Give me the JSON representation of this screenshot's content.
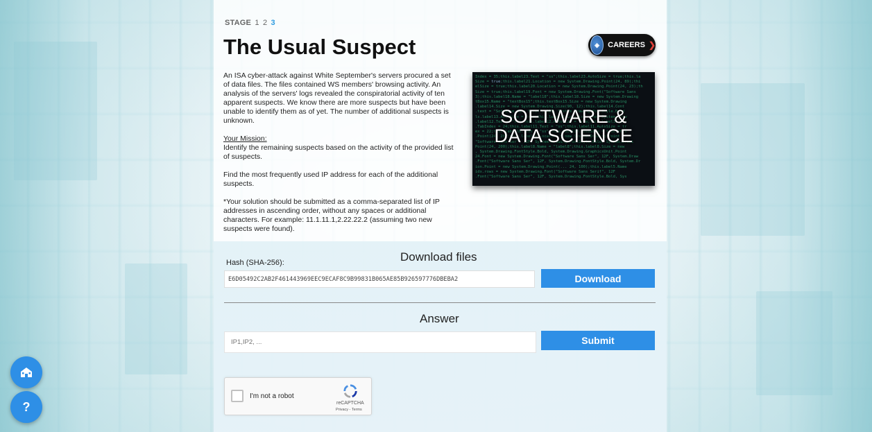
{
  "stage": {
    "label": "STAGE",
    "steps": [
      "1",
      "2",
      "3"
    ],
    "active": "3"
  },
  "page_title": "The Usual Suspect",
  "careers_button": {
    "label": "CAREERS",
    "icon": "chevron-right-icon"
  },
  "description": {
    "intro": "An ISA cyber-attack against White September's servers procured a set of data files. The files contained WS members' browsing activity. An analysis of the servers' logs revealed the conspiratorial activity of ten apparent suspects. We know there are more suspects but have been unable to identify them as of yet. The number of additional suspects is unknown.",
    "mission_heading": "Your Mission:",
    "mission_text": "Identify the remaining suspects based on the activity of the provided list of suspects.",
    "task_text": "Find the most frequently used IP address for each of the additional suspects.",
    "format_text": "*Your solution should be submitted as a comma-separated list of IP addresses in ascending order, without any spaces or additional characters. For example: 11.1.11.1,2.22.22.2 (assuming two new suspects were found)."
  },
  "hero_image": {
    "line1": "SOFTWARE &",
    "line2": "DATA SCIENCE"
  },
  "download": {
    "heading": "Download files",
    "hash_label": "Hash (SHA-256):",
    "hash_value": "E6D05492C2AB2F461443969EEC9ECAF8C9B99831B065AE85B926597776DBEBA2",
    "button_label": "Download"
  },
  "answer": {
    "heading": "Answer",
    "placeholder": "IP1,IP2, ...",
    "button_label": "Submit"
  },
  "recaptcha": {
    "checkbox_label": "I'm not a robot",
    "brand": "reCAPTCHA",
    "links": "Privacy - Terms"
  },
  "floating_buttons": {
    "home_icon": "home-icon",
    "help_icon": "?"
  },
  "colors": {
    "accent": "#2e8fe6",
    "stage_active": "#2e9be0"
  }
}
